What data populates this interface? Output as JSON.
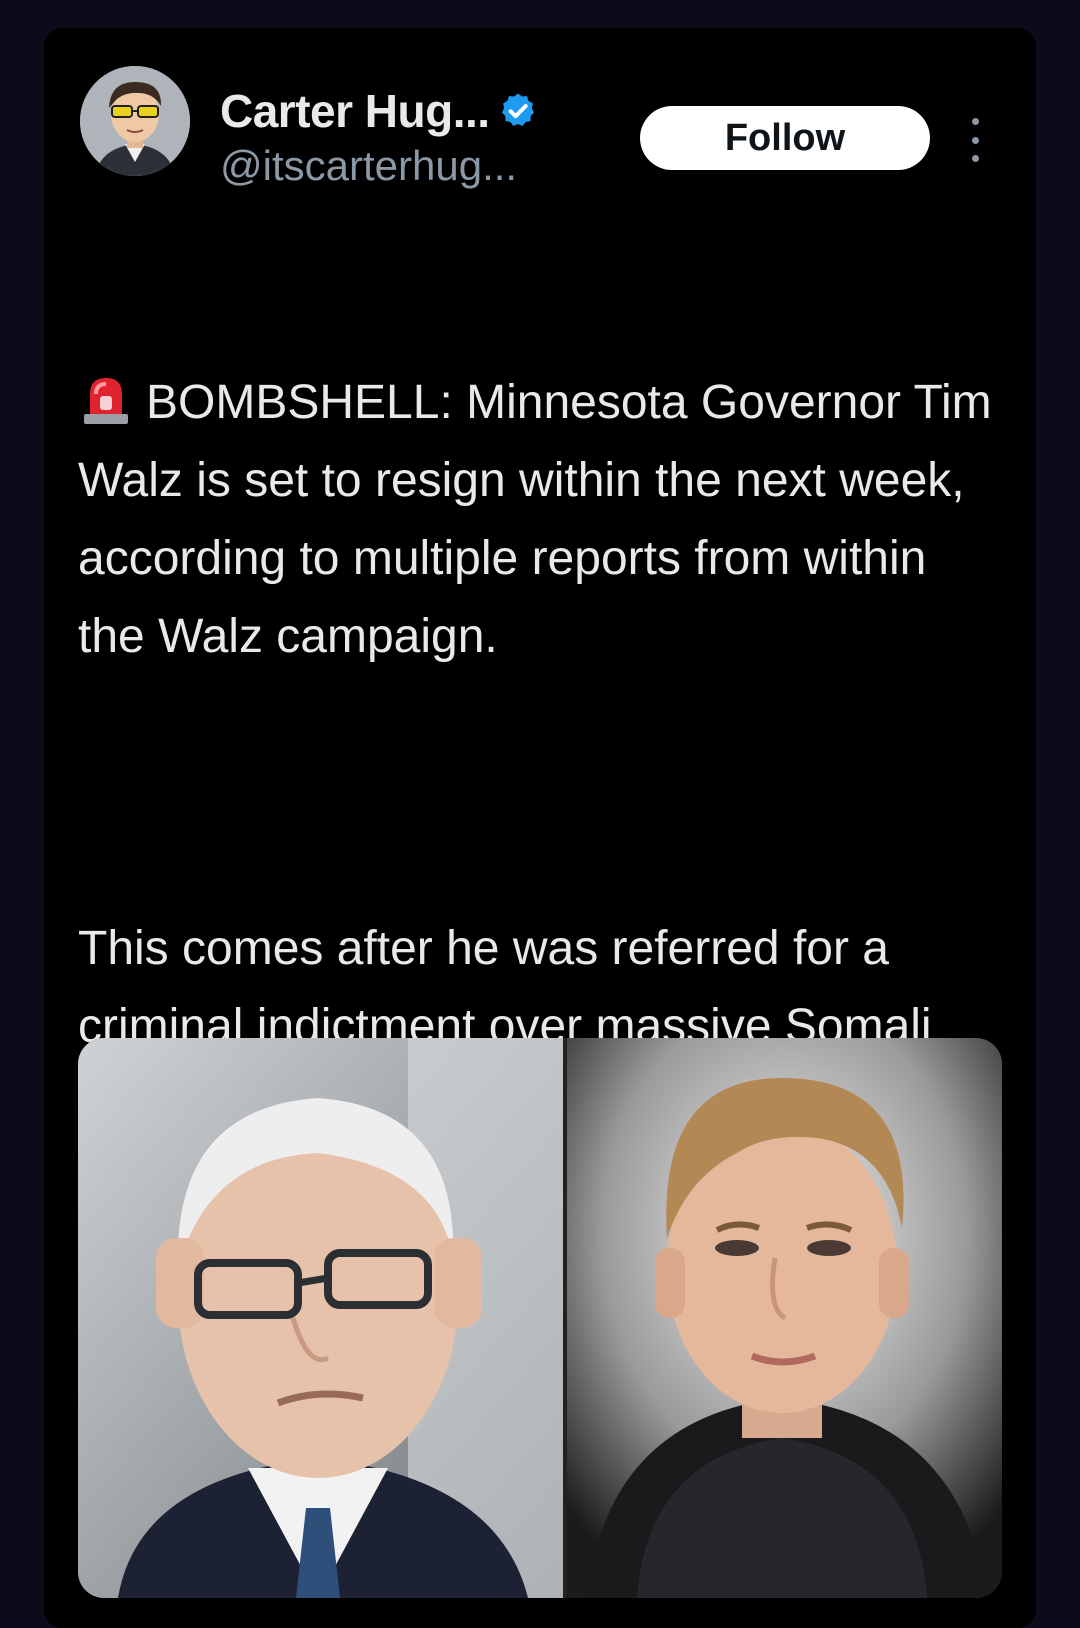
{
  "post": {
    "author": {
      "display_name": "Carter Hug...",
      "handle": "@itscarterhug...",
      "verified": true,
      "avatar_icon": "cartoon-avatar-icon"
    },
    "follow_label": "Follow",
    "more_icon": "more-vertical-icon",
    "text": {
      "paragraph1": "BOMBSHELL: Minnesota Governor Tim Walz is set to resign within the next week, according to multiple reports from within the Walz campaign.",
      "paragraph2": "This comes after he was referred for a criminal indictment over massive Somali fraud within the state.",
      "emoji_icon": "police-siren-icon"
    },
    "media": {
      "images": [
        {
          "name": "photo-older-man-glasses"
        },
        {
          "name": "photo-young-man-hoodie"
        }
      ]
    }
  },
  "colors": {
    "page_bg": "#0b0b1a",
    "card_bg": "#000000",
    "text_primary": "#e7e9ea",
    "text_secondary": "#8b98a5",
    "verified_blue": "#1d9bf0",
    "follow_bg": "#ffffff"
  }
}
